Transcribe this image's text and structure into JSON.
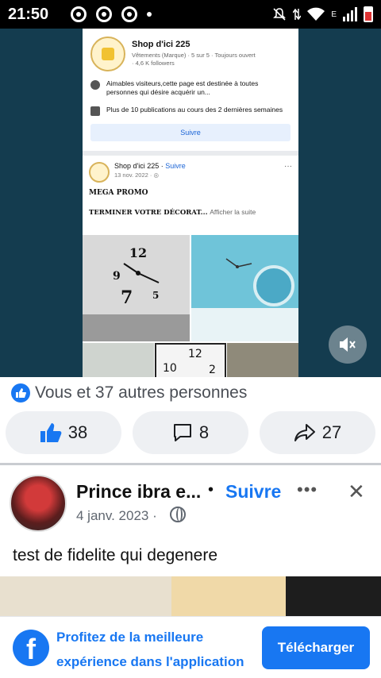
{
  "status_bar": {
    "time": "21:50",
    "network_type": "E",
    "icons": [
      "chrome-icon",
      "chrome-icon",
      "chrome-icon",
      "mute-icon",
      "data-arrows-icon",
      "wifi-icon",
      "signal-icon",
      "battery-icon"
    ]
  },
  "video": {
    "shop": {
      "name": "Shop d'ici 225",
      "meta_line1": "Vêtements (Marque) · 5 sur 5 · Toujours ouvert",
      "meta_line2": "· 4,6 K followers",
      "info1": "Aimables visiteurs,cette page est destinée à toutes personnes qui désire acquérir un...",
      "info2": "Plus de 10 publications au cours des 2 dernières semaines",
      "follow_label": "Suivre"
    },
    "post": {
      "author": "Shop d'ici 225",
      "separator": "·",
      "follow": "Suivre",
      "date": "13 nov. 2022 · ",
      "more": "···",
      "promo_title": "MEGA PROMO",
      "promo_text": "TERMINER VOTRE DÉCORAT...",
      "see_more": "Afficher la suite"
    },
    "mute_icon": "volume-mute-icon"
  },
  "reactions": {
    "text": "Vous et 37 autres personnes"
  },
  "actions": {
    "like_count": "38",
    "comment_count": "8",
    "share_count": "27"
  },
  "next_post": {
    "author": "Prince ibra e...",
    "separator": "•",
    "follow_label": "Suivre",
    "more": "•••",
    "close": "✕",
    "date": "4 janv. 2023",
    "date_sep": "·",
    "text": "test de fidelite qui degenere"
  },
  "banner": {
    "line1": "Profitez de la meilleure",
    "line2": "expérience dans l'application",
    "download_label": "Télécharger",
    "fb_letter": "f"
  },
  "colors": {
    "brand_blue": "#1877f2",
    "video_bg": "#143c4f"
  }
}
